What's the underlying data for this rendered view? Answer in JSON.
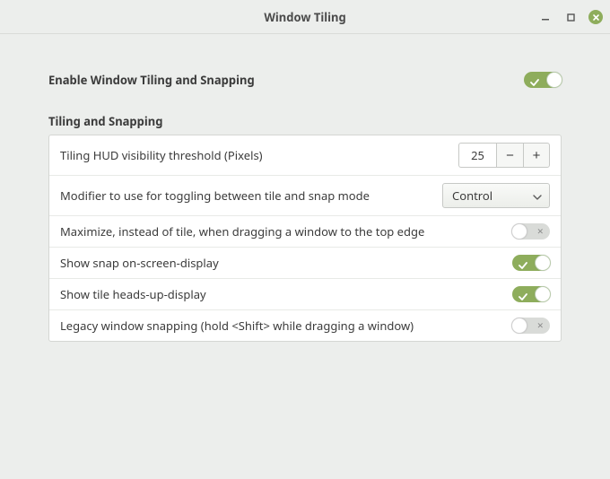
{
  "window": {
    "title": "Window Tiling"
  },
  "master": {
    "label": "Enable Window Tiling and Snapping",
    "enabled": true
  },
  "section": {
    "title": "Tiling and Snapping"
  },
  "rows": {
    "hud_threshold": {
      "label": "Tiling HUD visibility threshold (Pixels)",
      "value": "25"
    },
    "modifier": {
      "label": "Modifier to use for toggling between tile and snap mode",
      "selected": "Control"
    },
    "maximize_top": {
      "label": "Maximize, instead of tile, when dragging a window to the top edge",
      "enabled": false
    },
    "snap_osd": {
      "label": "Show snap on-screen-display",
      "enabled": true
    },
    "tile_hud": {
      "label": "Show tile heads-up-display",
      "enabled": true
    },
    "legacy": {
      "label": "Legacy window snapping (hold <Shift> while dragging a window)",
      "enabled": false
    }
  }
}
